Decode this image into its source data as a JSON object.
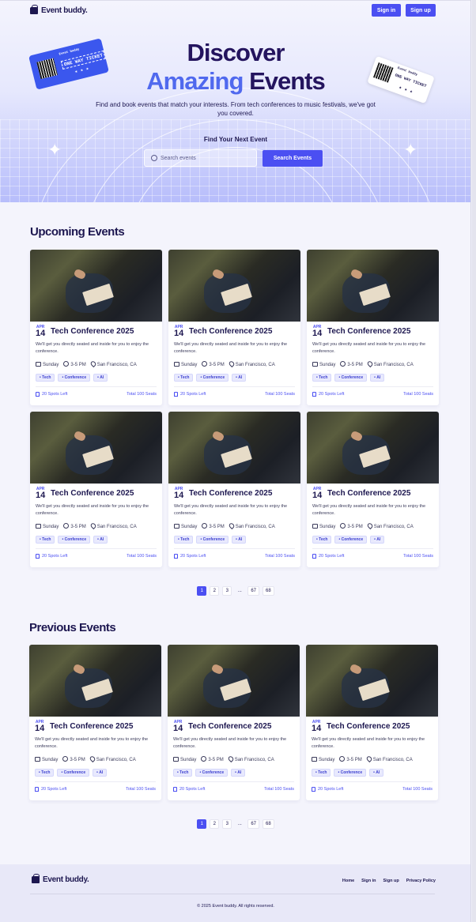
{
  "brand": {
    "name": "Event buddy."
  },
  "nav": {
    "signin": "Sign in",
    "signup": "Sign up"
  },
  "hero": {
    "title_line1": "Discover",
    "title_highlight": "Amazing",
    "title_rest": "Events",
    "subtitle": "Find and book events that match your interests. From tech conferences to music festivals, we've got you covered.",
    "find_label": "Find Your Next Event",
    "search_placeholder": "Search events",
    "search_button": "Search Events",
    "ticket_left": {
      "text": "ONE WAY TICKET",
      "brand": "Event buddy",
      "stars": "★ ★ ★"
    },
    "ticket_right": {
      "text": "ONE WAY TICKET",
      "brand": "Event buddy",
      "stars": "★ ★ ★"
    }
  },
  "upcoming": {
    "title": "Upcoming Events",
    "events": [
      {
        "month": "APR",
        "day": "14",
        "title": "Tech Conference 2025",
        "desc": "We'll get you directly seated and inside for you to enjoy the conference.",
        "day_name": "Sunday",
        "time": "3-5 PM",
        "location": "San Francisco, CA",
        "tags": [
          "Tech",
          "Conference",
          "AI"
        ],
        "spots": "20 Spots Left",
        "total": "Total 100 Seats"
      },
      {
        "month": "APR",
        "day": "14",
        "title": "Tech Conference 2025",
        "desc": "We'll get you directly seated and inside for you to enjoy the conference.",
        "day_name": "Sunday",
        "time": "3-5 PM",
        "location": "San Francisco, CA",
        "tags": [
          "Tech",
          "Conference",
          "AI"
        ],
        "spots": "20 Spots Left",
        "total": "Total 100 Seats"
      },
      {
        "month": "APR",
        "day": "14",
        "title": "Tech Conference 2025",
        "desc": "We'll get you directly seated and inside for you to enjoy the conference.",
        "day_name": "Sunday",
        "time": "3-5 PM",
        "location": "San Francisco, CA",
        "tags": [
          "Tech",
          "Conference",
          "AI"
        ],
        "spots": "20 Spots Left",
        "total": "Total 100 Seats"
      },
      {
        "month": "APR",
        "day": "14",
        "title": "Tech Conference 2025",
        "desc": "We'll get you directly seated and inside for you to enjoy the conference.",
        "day_name": "Sunday",
        "time": "3-5 PM",
        "location": "San Francisco, CA",
        "tags": [
          "Tech",
          "Conference",
          "AI"
        ],
        "spots": "20 Spots Left",
        "total": "Total 100 Seats"
      },
      {
        "month": "APR",
        "day": "14",
        "title": "Tech Conference 2025",
        "desc": "We'll get you directly seated and inside for you to enjoy the conference.",
        "day_name": "Sunday",
        "time": "3-5 PM",
        "location": "San Francisco, CA",
        "tags": [
          "Tech",
          "Conference",
          "AI"
        ],
        "spots": "20 Spots Left",
        "total": "Total 100 Seats"
      },
      {
        "month": "APR",
        "day": "14",
        "title": "Tech Conference 2025",
        "desc": "We'll get you directly seated and inside for you to enjoy the conference.",
        "day_name": "Sunday",
        "time": "3-5 PM",
        "location": "San Francisco, CA",
        "tags": [
          "Tech",
          "Conference",
          "AI"
        ],
        "spots": "20 Spots Left",
        "total": "Total 100 Seats"
      }
    ],
    "pagination": [
      "1",
      "2",
      "3",
      "...",
      "67",
      "68"
    ],
    "active_page": "1"
  },
  "previous": {
    "title": "Previous Events",
    "events": [
      {
        "month": "APR",
        "day": "14",
        "title": "Tech Conference 2025",
        "desc": "We'll get you directly seated and inside for you to enjoy the conference.",
        "day_name": "Sunday",
        "time": "3-5 PM",
        "location": "San Francisco, CA",
        "tags": [
          "Tech",
          "Conference",
          "AI"
        ],
        "spots": "20 Spots Left",
        "total": "Total 100 Seats"
      },
      {
        "month": "APR",
        "day": "14",
        "title": "Tech Conference 2025",
        "desc": "We'll get you directly seated and inside for you to enjoy the conference.",
        "day_name": "Sunday",
        "time": "3-5 PM",
        "location": "San Francisco, CA",
        "tags": [
          "Tech",
          "Conference",
          "AI"
        ],
        "spots": "20 Spots Left",
        "total": "Total 100 Seats"
      },
      {
        "month": "APR",
        "day": "14",
        "title": "Tech Conference 2025",
        "desc": "We'll get you directly seated and inside for you to enjoy the conference.",
        "day_name": "Sunday",
        "time": "3-5 PM",
        "location": "San Francisco, CA",
        "tags": [
          "Tech",
          "Conference",
          "AI"
        ],
        "spots": "20 Spots Left",
        "total": "Total 100 Seats"
      }
    ],
    "pagination": [
      "1",
      "2",
      "3",
      "...",
      "67",
      "68"
    ],
    "active_page": "1"
  },
  "footer": {
    "links": [
      "Home",
      "Sign in",
      "Sign up",
      "Privacy Policy"
    ],
    "copyright": "© 2025 Event buddy. All rights reserved."
  },
  "colors": {
    "primary": "#4b4ff2",
    "dark": "#1d1750",
    "gradient_word": "#5069ee"
  },
  "icons": {
    "logo": "bag-icon",
    "search": "search-icon",
    "calendar": "calendar-icon",
    "clock": "clock-icon",
    "location": "location-pin-icon",
    "seat": "seat-icon",
    "sparkle": "sparkle-icon"
  }
}
